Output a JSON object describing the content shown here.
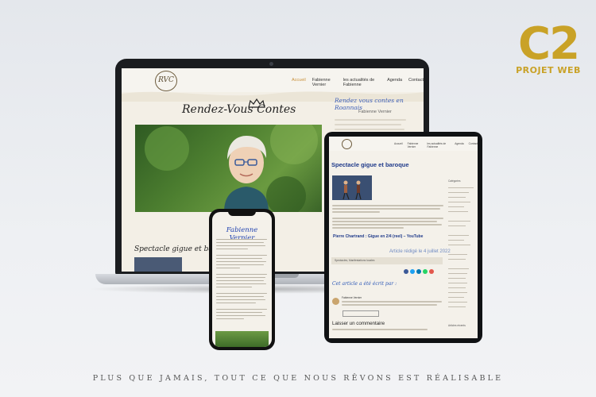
{
  "brand": {
    "mark": "C2",
    "sub": "PROJET WEB",
    "accent": "#c9a227"
  },
  "tagline": "PLUS QUE JAMAIS, TOUT CE QUE NOUS RÊVONS EST RÉALISABLE",
  "laptop": {
    "nav": [
      "Accueil",
      "Fabienne Vernier",
      "les actualités de Fabienne",
      "Agenda",
      "Contact"
    ],
    "site_title": "Rendez-Vous Contes",
    "sidebar_title": "Rendez vous contes en Roannais",
    "sidebar_subtitle": "Fabienne Vernier",
    "post_title": "Spectacle gigue et baroque"
  },
  "tablet": {
    "nav": [
      "Accueil",
      "Fabienne Vernier",
      "les actualités de Fabienne",
      "Agenda",
      "Contact"
    ],
    "post_title": "Spectacle gigue et baroque",
    "video_title": "Pierre Chartrand : Gigue en 2/4 (reel) – YouTube",
    "date": "Article rédigé le 4 juillet 2022",
    "tags": "Spectacles, Manifestations locales",
    "comments_heading": "Cet article a été écrit par :",
    "author": "Fabienne Vernier",
    "leave_comment": "Laisser un commentaire",
    "sidebar": "Catégories",
    "sidebar_bottom": "Articles récents"
  },
  "phone": {
    "title": "Fabienne Vernier"
  }
}
